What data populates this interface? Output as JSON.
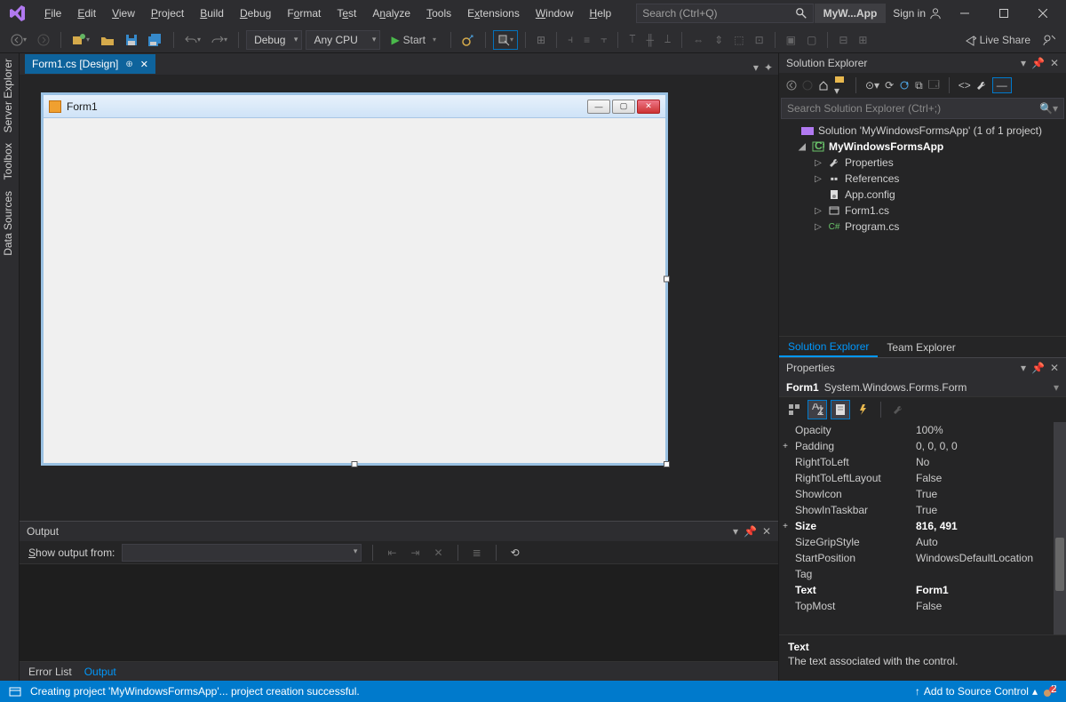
{
  "title": {
    "appName": "MyW...App",
    "signIn": "Sign in",
    "searchPlaceholder": "Search (Ctrl+Q)"
  },
  "menu": [
    "File",
    "Edit",
    "View",
    "Project",
    "Build",
    "Debug",
    "Format",
    "Test",
    "Analyze",
    "Tools",
    "Extensions",
    "Window",
    "Help"
  ],
  "toolbar": {
    "config": "Debug",
    "platform": "Any CPU",
    "start": "Start",
    "liveShare": "Live Share"
  },
  "leftRail": [
    "Server Explorer",
    "Toolbox",
    "Data Sources"
  ],
  "docTab": {
    "name": "Form1.cs [Design]"
  },
  "designer": {
    "formTitle": "Form1"
  },
  "output": {
    "title": "Output",
    "showFromLabel": "Show output from:",
    "tabs": {
      "errorList": "Error List",
      "output": "Output"
    }
  },
  "solutionExplorer": {
    "title": "Solution Explorer",
    "searchPlaceholder": "Search Solution Explorer (Ctrl+;)",
    "solution": "Solution 'MyWindowsFormsApp' (1 of 1 project)",
    "project": "MyWindowsFormsApp",
    "nodes": {
      "properties": "Properties",
      "references": "References",
      "appconfig": "App.config",
      "form1": "Form1.cs",
      "program": "Program.cs"
    },
    "tabs": {
      "solution": "Solution Explorer",
      "team": "Team Explorer"
    }
  },
  "properties": {
    "title": "Properties",
    "objName": "Form1",
    "objType": "System.Windows.Forms.Form",
    "rows": [
      {
        "k": "Opacity",
        "v": "100%"
      },
      {
        "k": "Padding",
        "v": "0, 0, 0, 0",
        "exp": "+"
      },
      {
        "k": "RightToLeft",
        "v": "No"
      },
      {
        "k": "RightToLeftLayout",
        "v": "False"
      },
      {
        "k": "ShowIcon",
        "v": "True"
      },
      {
        "k": "ShowInTaskbar",
        "v": "True"
      },
      {
        "k": "Size",
        "v": "816, 491",
        "exp": "+",
        "bold": true
      },
      {
        "k": "SizeGripStyle",
        "v": "Auto"
      },
      {
        "k": "StartPosition",
        "v": "WindowsDefaultLocation"
      },
      {
        "k": "Tag",
        "v": ""
      },
      {
        "k": "Text",
        "v": "Form1",
        "bold": true
      },
      {
        "k": "TopMost",
        "v": "False"
      }
    ],
    "descTitle": "Text",
    "descBody": "The text associated with the control."
  },
  "status": {
    "message": "Creating project 'MyWindowsFormsApp'... project creation successful.",
    "sourceControl": "Add to Source Control"
  }
}
